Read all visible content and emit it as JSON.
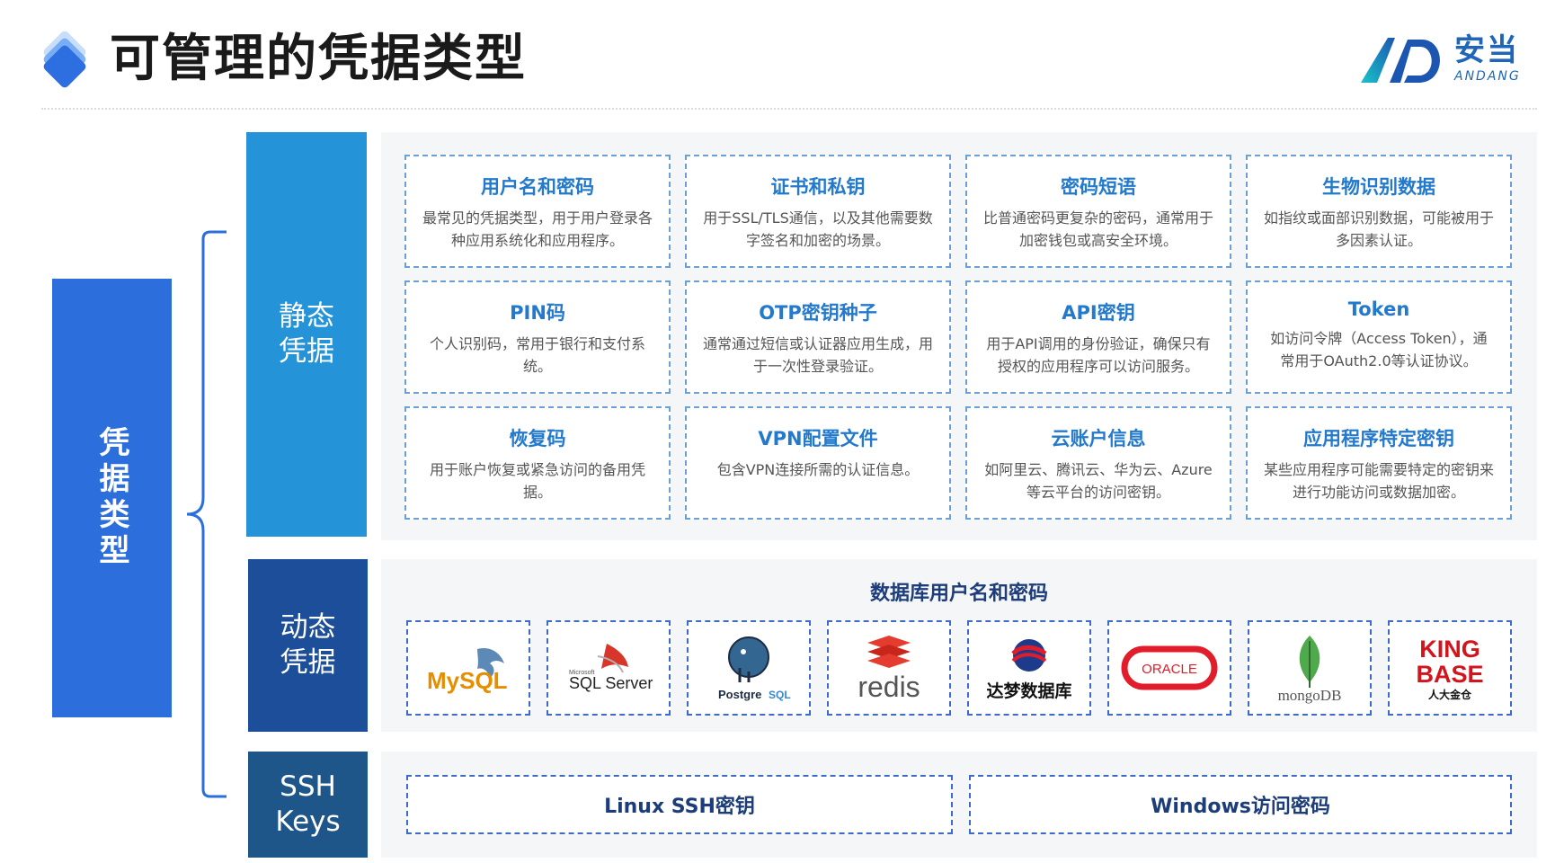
{
  "header": {
    "title": "可管理的凭据类型",
    "logo_cn": "安当",
    "logo_en": "ANDANG"
  },
  "root_label": "凭据类型",
  "categories": {
    "static": "静态\n凭据",
    "dynamic": "动态\n凭据",
    "ssh": "SSH\nKeys"
  },
  "static_cards": [
    {
      "title": "用户名和密码",
      "desc": "最常见的凭据类型，用于用户登录各种应用系统化和应用程序。"
    },
    {
      "title": "证书和私钥",
      "desc": "用于SSL/TLS通信，以及其他需要数字签名和加密的场景。"
    },
    {
      "title": "密码短语",
      "desc": "比普通密码更复杂的密码，通常用于加密钱包或高安全环境。"
    },
    {
      "title": "生物识别数据",
      "desc": "如指纹或面部识别数据，可能被用于多因素认证。"
    },
    {
      "title": "PIN码",
      "desc": "个人识别码，常用于银行和支付系统。"
    },
    {
      "title": "OTP密钥种子",
      "desc": "通常通过短信或认证器应用生成，用于一次性登录验证。"
    },
    {
      "title": "API密钥",
      "desc": "用于API调用的身份验证，确保只有授权的应用程序可以访问服务。"
    },
    {
      "title": "Token",
      "desc": "如访问令牌（Access Token），通常用于OAuth2.0等认证协议。"
    },
    {
      "title": "恢复码",
      "desc": "用于账户恢复或紧急访问的备用凭据。"
    },
    {
      "title": "VPN配置文件",
      "desc": "包含VPN连接所需的认证信息。"
    },
    {
      "title": "云账户信息",
      "desc": "如阿里云、腾讯云、华为云、Azure等云平台的访问密钥。"
    },
    {
      "title": "应用程序特定密钥",
      "desc": "某些应用程序可能需要特定的密钥来进行功能访问或数据加密。"
    }
  ],
  "dynamic": {
    "title": "数据库用户名和密码",
    "databases": [
      {
        "name": "MySQL",
        "icon": "mysql-dolphin-icon"
      },
      {
        "name": "SQL Server",
        "small": "Microsoft",
        "icon": "sqlserver-icon"
      },
      {
        "name": "Postgre",
        "name2": "SQL",
        "icon": "postgres-elephant-icon"
      },
      {
        "name": "redis",
        "icon": "redis-cubes-icon"
      },
      {
        "name": "达梦数据库",
        "icon": "dameng-icon"
      },
      {
        "name": "ORACLE",
        "icon": "oracle-icon"
      },
      {
        "name": "mongoDB",
        "icon": "mongodb-leaf-icon"
      },
      {
        "name": "KING",
        "name2": "BASE",
        "small": "人大金仓",
        "icon": "kingbase-icon"
      }
    ]
  },
  "ssh": {
    "items": [
      "Linux SSH密钥",
      "Windows访问密码"
    ]
  },
  "colors": {
    "root": "#2c6fdc",
    "static": "#2593d8",
    "dynamic": "#1d4e9a",
    "ssh": "#1f5689",
    "card_title": "#2379cc",
    "card_border": "#6aa0d6"
  }
}
